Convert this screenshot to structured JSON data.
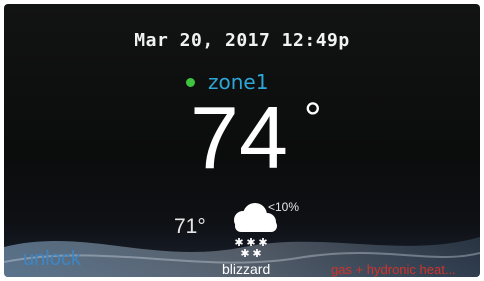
{
  "datetime": "Mar 20, 2017 12:49p",
  "zone": {
    "name": "zone1",
    "status_color": "#3fc43f"
  },
  "indoor_temp": {
    "value": "74",
    "degree": "°"
  },
  "outdoor": {
    "temp": "71°",
    "precip_chance": "<10%",
    "condition": "blizzard",
    "icon": "snow-cloud-icon"
  },
  "controls": {
    "unlock_label": "unlock",
    "mode_label": "gas + hydronic heat..."
  },
  "colors": {
    "zone_label": "#2fa6d8",
    "unlock": "#3c86c6",
    "mode": "#d2332a",
    "background": "#0b0c0c"
  }
}
